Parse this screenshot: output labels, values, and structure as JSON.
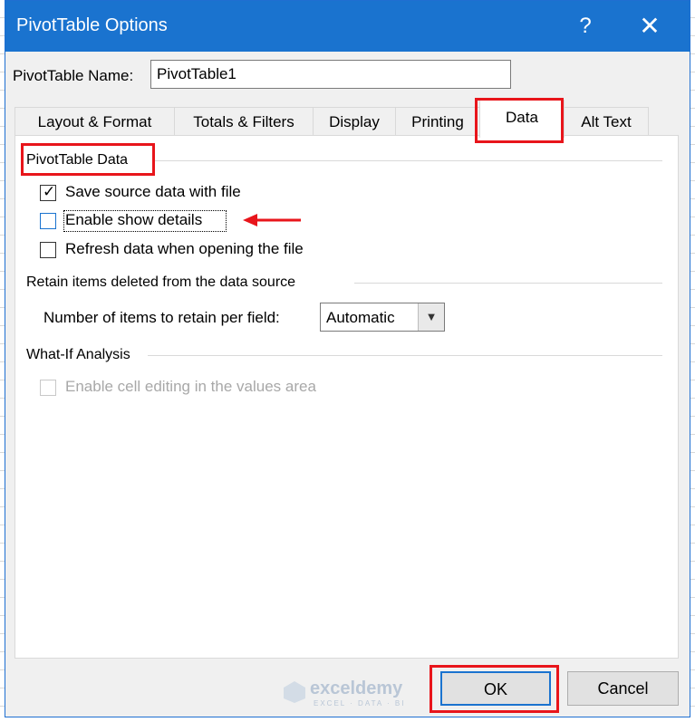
{
  "window": {
    "title": "PivotTable Options",
    "help_label": "?",
    "close_label": "✕"
  },
  "name_field": {
    "label": "PivotTable Name:",
    "value": "PivotTable1"
  },
  "tabs": [
    {
      "label": "Layout & Format",
      "active": false
    },
    {
      "label": "Totals & Filters",
      "active": false
    },
    {
      "label": "Display",
      "active": false
    },
    {
      "label": "Printing",
      "active": false
    },
    {
      "label": "Data",
      "active": true
    },
    {
      "label": "Alt Text",
      "active": false
    }
  ],
  "data_tab": {
    "section_pivot": {
      "title": "PivotTable Data",
      "options": [
        {
          "label": "Save source data with file",
          "checked": true,
          "enabled": true
        },
        {
          "label": "Enable show details",
          "checked": false,
          "enabled": true,
          "focused": true
        },
        {
          "label": "Refresh data when opening the file",
          "checked": false,
          "enabled": true
        }
      ]
    },
    "section_retain": {
      "title": "Retain items deleted from the data source",
      "select_label": "Number of items to retain per field:",
      "select_value": "Automatic"
    },
    "section_whatif": {
      "title": "What-If Analysis",
      "option": {
        "label": "Enable cell editing in the values area",
        "checked": false,
        "enabled": false
      }
    }
  },
  "buttons": {
    "ok": "OK",
    "cancel": "Cancel"
  },
  "watermark": {
    "brand": "exceldemy",
    "tagline": "EXCEL · DATA · BI"
  },
  "colors": {
    "titlebar": "#1a73cf",
    "highlight": "#e8151b",
    "dialog_bg": "#f0f0f0"
  }
}
